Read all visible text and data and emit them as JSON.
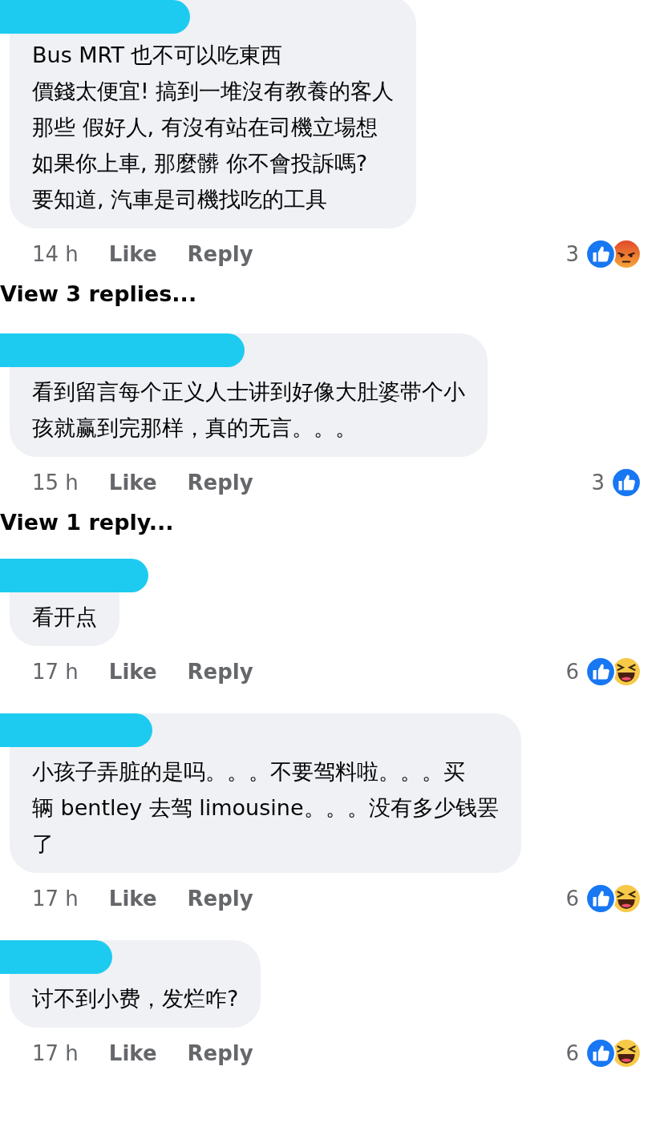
{
  "comments": [
    {
      "lines": [
        "Bus MRT 也不可以吃東西",
        "價錢太便宜! 搞到一堆沒有教養的客人",
        "那些 假好人, 有沒有站在司機立場想",
        "如果你上車, 那麼髒 你不會投訴嗎?",
        "要知道, 汽車是司機找吃的工具"
      ],
      "time": "14 h",
      "like": "Like",
      "reply": "Reply",
      "reaction_count": "3",
      "reactions": [
        {
          "kind": "like"
        },
        {
          "kind": "angry"
        }
      ],
      "view_replies": "View 3 replies..."
    },
    {
      "lines": [
        "看到留言每个正义人士讲到好像大肚婆带个小",
        "孩就赢到完那样，真的无言。。。"
      ],
      "time": "15 h",
      "like": "Like",
      "reply": "Reply",
      "reaction_count": "3",
      "reactions": [
        {
          "kind": "like"
        }
      ],
      "view_replies": "View 1 reply..."
    },
    {
      "lines": [
        "看开点"
      ],
      "time": "17 h",
      "like": "Like",
      "reply": "Reply",
      "reaction_count": "6",
      "reactions": [
        {
          "kind": "like"
        },
        {
          "kind": "haha"
        }
      ]
    },
    {
      "lines": [
        "小孩子弄脏的是吗。。。不要驾料啦。。。买",
        "辆 bentley 去驾 limousine。。。没有多少钱罢",
        "了"
      ],
      "time": "17 h",
      "like": "Like",
      "reply": "Reply",
      "reaction_count": "6",
      "reactions": [
        {
          "kind": "like"
        },
        {
          "kind": "haha"
        }
      ]
    },
    {
      "lines": [
        "讨不到小费，发烂咋?"
      ],
      "time": "17 h",
      "like": "Like",
      "reply": "Reply",
      "reaction_count": "6",
      "reactions": [
        {
          "kind": "like"
        },
        {
          "kind": "haha"
        }
      ]
    }
  ]
}
